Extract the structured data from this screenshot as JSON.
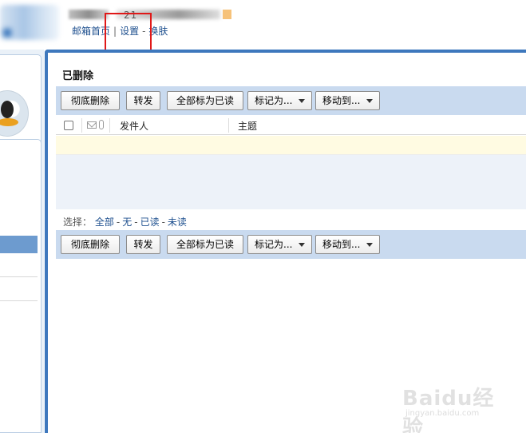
{
  "header": {
    "account_text": "21",
    "links": [
      "邮箱首页",
      "设置",
      "换肤"
    ],
    "separators": [
      "|",
      "-"
    ]
  },
  "main": {
    "folder_title": "已删除",
    "toolbar": {
      "delete_permanently": "彻底删除",
      "forward": "转发",
      "mark_all_read": "全部标为已读",
      "mark_as": "标记为...",
      "move_to": "移动到..."
    },
    "columns": {
      "sender": "发件人",
      "subject": "主题"
    },
    "select": {
      "label": "选择：",
      "options": [
        "全部",
        "无",
        "已读",
        "未读"
      ],
      "separator": "-"
    }
  },
  "watermark": {
    "text": "Baidu经验",
    "url": "jingyan.baidu.com"
  },
  "colors": {
    "accent": "#3e78bd",
    "toolbar_bg": "#c9daef",
    "link": "#1d4f8e",
    "highlight_box": "#e01818"
  }
}
